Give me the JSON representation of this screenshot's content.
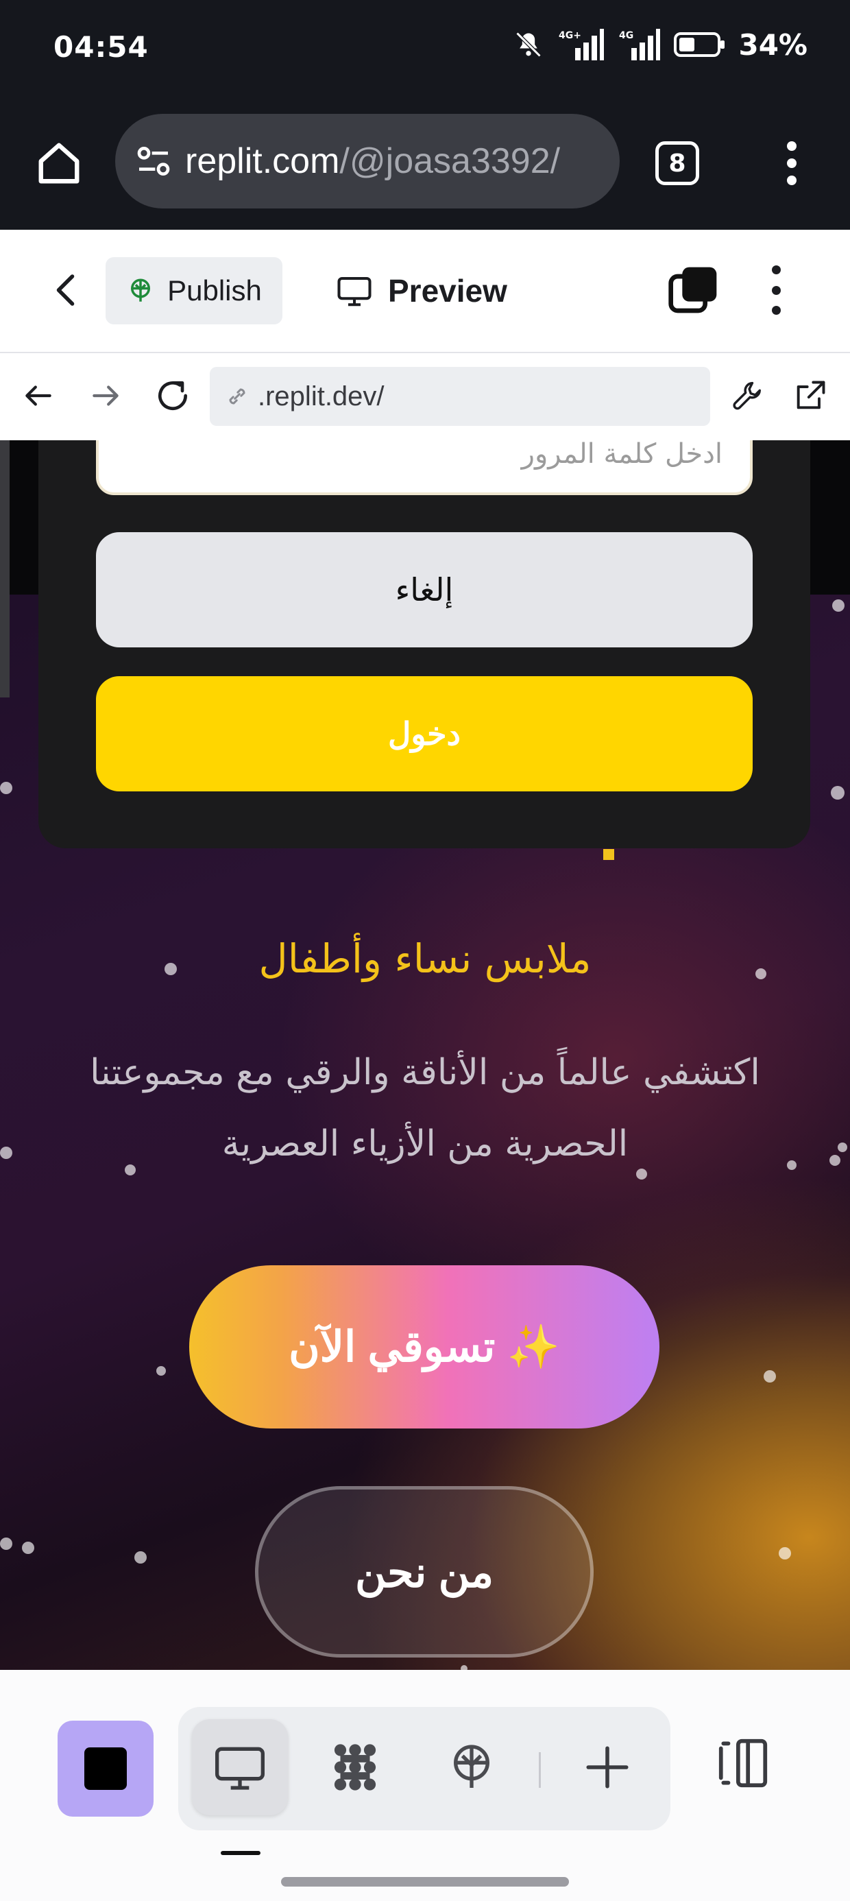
{
  "status_bar": {
    "time": "04:54",
    "battery_percent": "34%",
    "signal_1": "4G+",
    "signal_2": "4G"
  },
  "browser": {
    "url_host": "replit.com",
    "url_path": "/@joasa3392/",
    "tab_count": "8"
  },
  "replit_header": {
    "publish_label": "Publish",
    "preview_label": "Preview"
  },
  "web_nav": {
    "address": ".replit.dev/"
  },
  "page": {
    "password_placeholder": "ادخل كلمة المرور",
    "cancel_label": "إلغاء",
    "login_label": "دخول",
    "hero_title": "ملابس نساء وأطفال",
    "hero_subtitle": "اكتشفي عالماً من الأناقة والرقي مع مجموعتنا الحصرية من الأزياء العصرية",
    "shop_now_label": "تسوقي الآن ✨",
    "about_label": "من نحن"
  },
  "colors": {
    "accent_yellow": "#ffd600",
    "stop_button": "#b6a6f5",
    "hero_title": "#f4c21a"
  }
}
